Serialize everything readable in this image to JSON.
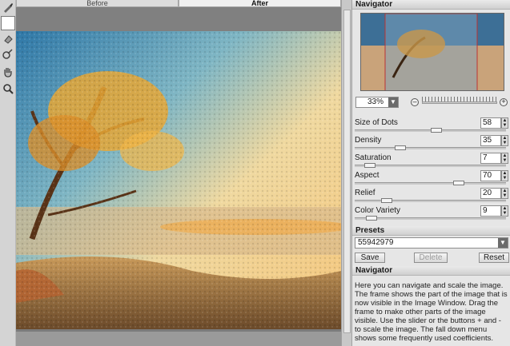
{
  "tabs": {
    "before": "Before",
    "after": "After"
  },
  "navigator": {
    "title": "Navigator",
    "zoom": "33%"
  },
  "params": [
    {
      "label": "Size of Dots",
      "value": "58"
    },
    {
      "label": "Density",
      "value": "35"
    },
    {
      "label": "Saturation",
      "value": "7"
    },
    {
      "label": "Aspect",
      "value": "70"
    },
    {
      "label": "Relief",
      "value": "20"
    },
    {
      "label": "Color Variety",
      "value": "9"
    }
  ],
  "presets": {
    "title": "Presets",
    "value": "55942979",
    "save": "Save",
    "delete": "Delete",
    "reset": "Reset"
  },
  "help": {
    "title": "Navigator",
    "text": "Here you can navigate and scale the image. The frame shows the part of the image that is now visible in the Image Window. Drag the frame to make other parts of the image visible. Use the slider or the buttons + and - to scale the image. The fall down menu shows some frequently used coefficients."
  },
  "icons": [
    "brush-icon",
    "eraser-icon",
    "history-brush-icon",
    "hand-icon",
    "zoom-icon",
    "color-swatch-icon"
  ]
}
